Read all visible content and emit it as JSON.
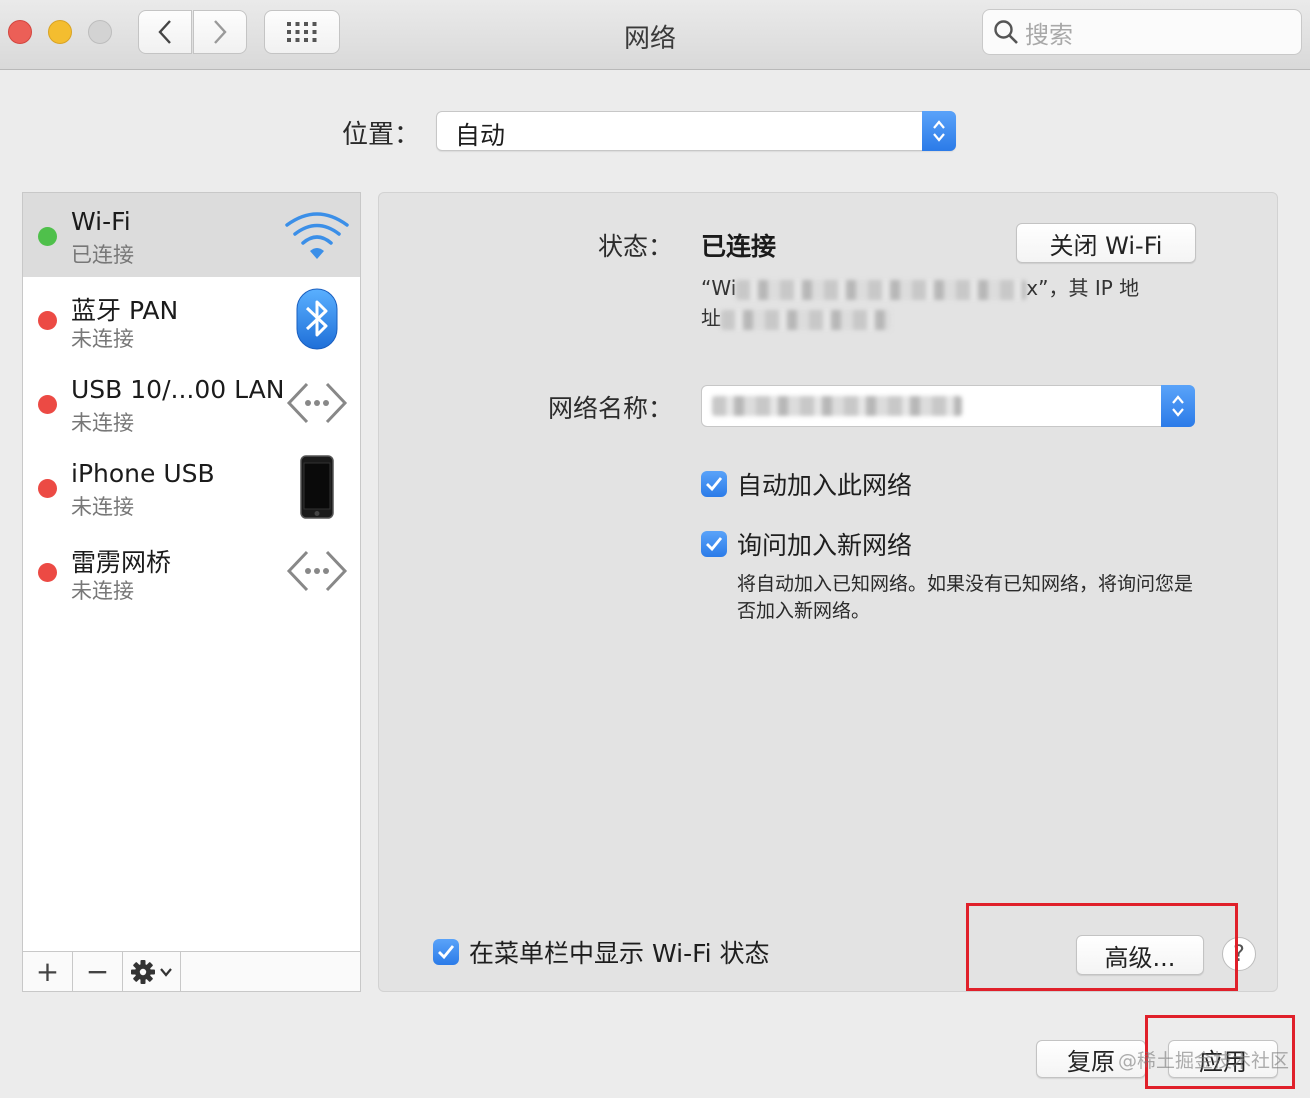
{
  "window": {
    "title": "网络",
    "search_placeholder": "搜索"
  },
  "location": {
    "label": "位置：",
    "value": "自动"
  },
  "services": [
    {
      "name": "Wi-Fi",
      "status": "已连接",
      "status_color": "#4fc04b",
      "icon": "wifi-icon",
      "selected": true
    },
    {
      "name": "蓝牙 PAN",
      "status": "未连接",
      "status_color": "#ec4a44",
      "icon": "bluetooth-icon",
      "selected": false
    },
    {
      "name": "USB 10/...00 LAN",
      "status": "未连接",
      "status_color": "#ec4a44",
      "icon": "ethernet-icon",
      "selected": false
    },
    {
      "name": "iPhone USB",
      "status": "未连接",
      "status_color": "#ec4a44",
      "icon": "iphone-icon",
      "selected": false
    },
    {
      "name": "雷雳网桥",
      "status": "未连接",
      "status_color": "#ec4a44",
      "icon": "ethernet-icon",
      "selected": false
    }
  ],
  "sidebar_toolbar": {
    "add": "+",
    "remove": "−"
  },
  "detail": {
    "status_label": "状态：",
    "status_value": "已连接",
    "turn_off_button": "关闭 Wi-Fi",
    "status_desc_start": "“Wi",
    "status_desc_end": "x”，其 IP 地",
    "status_desc_line2": "址",
    "network_name_label": "网络名称：",
    "auto_join_label": "自动加入此网络",
    "ask_join_label": "询问加入新网络",
    "ask_join_hint": "将自动加入已知网络。如果没有已知网络，将询问您是否加入新网络。",
    "show_status_label": "在菜单栏中显示 Wi-Fi 状态",
    "advanced_button": "高级...",
    "help": "?"
  },
  "footer": {
    "revert_button": "复原",
    "apply_button": "应用",
    "watermark": "@稀土掘金技术社区"
  },
  "colors": {
    "accent": "#2b7be8",
    "highlight_box": "#e0202a"
  }
}
